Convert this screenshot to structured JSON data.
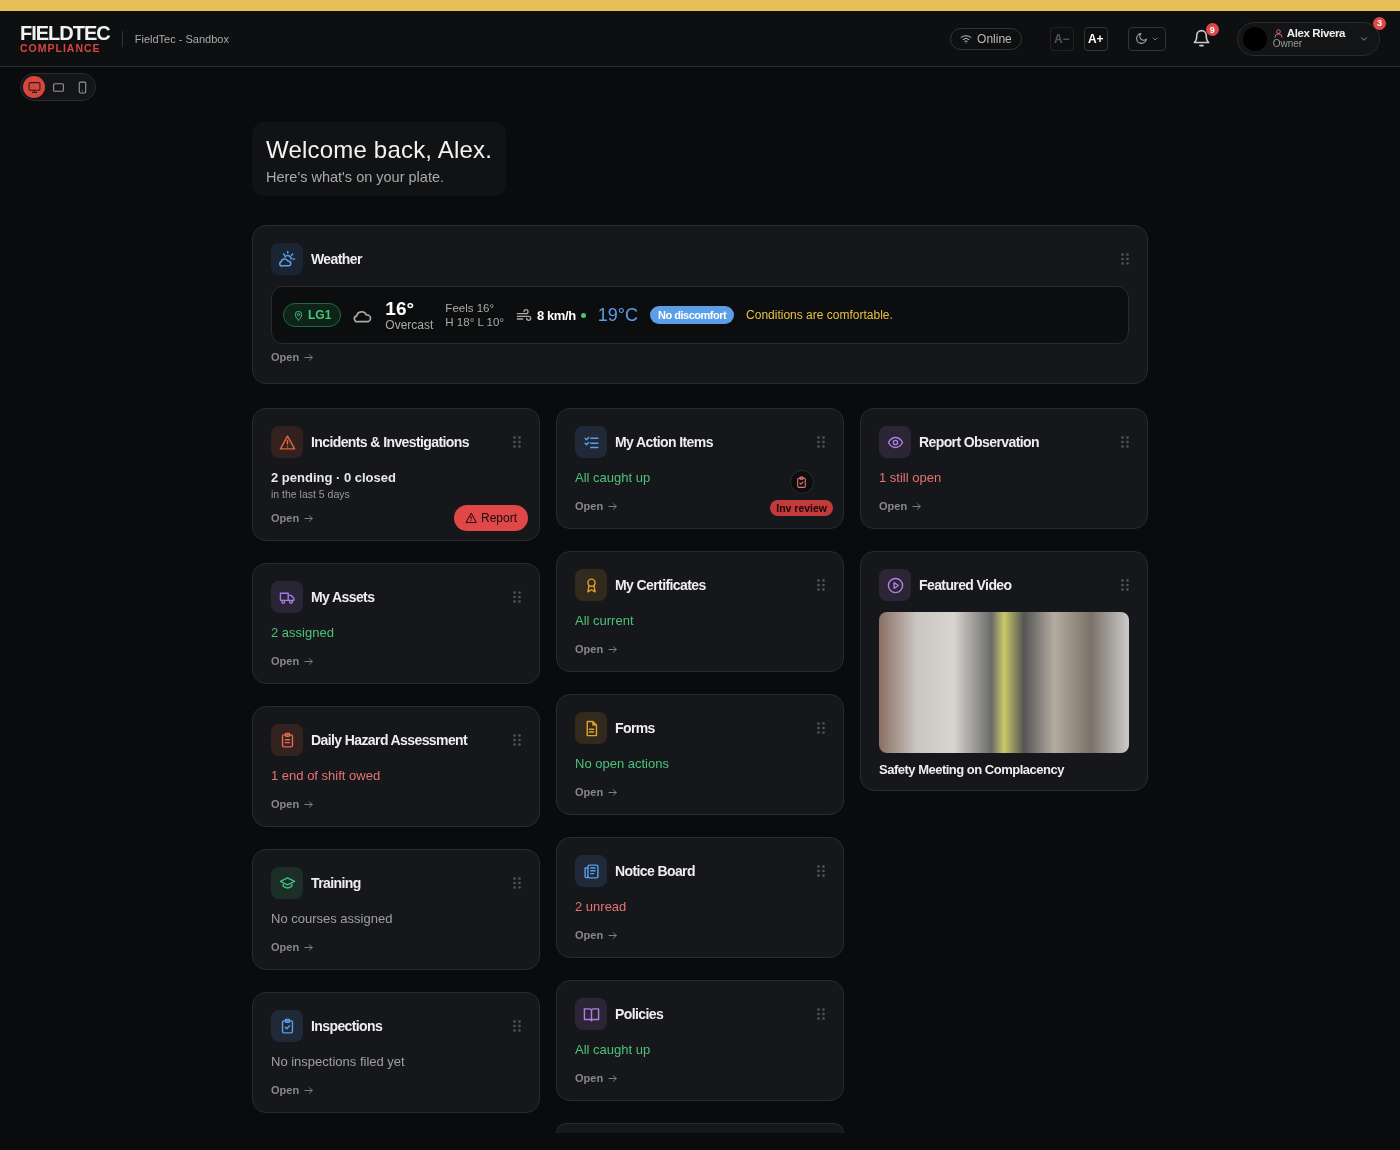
{
  "header": {
    "logo": {
      "line_1": "FIELDTEC",
      "line_2": "COMPLIANCE"
    },
    "workspace": "FieldTec - Sandbox",
    "connection": "Online",
    "font_buttons": [
      {
        "label": "A−",
        "disabled": true
      },
      {
        "label": "A+",
        "disabled": false
      }
    ],
    "theme": {
      "dark": true
    },
    "notifications": "9",
    "user": {
      "name": "Alex Rivera",
      "role": "Owner",
      "badge": "3"
    }
  },
  "devices": [
    {
      "kind": "desktop",
      "selected": true
    },
    {
      "kind": "tablet",
      "selected": false
    },
    {
      "kind": "phone",
      "selected": false
    }
  ],
  "welcome": {
    "title": "Welcome back, Alex.",
    "subtitle": "Here's what's on your plate."
  },
  "weather": {
    "title": "Weather",
    "location": "LG1",
    "temperature": "16°",
    "condition": "Overcast",
    "feels": "Feels 16°",
    "high_low": "H 18° L 10°",
    "wind": "8 km/h",
    "indoor": "19°C",
    "comfort": "No discomfort",
    "message": "Conditions are comfortable.",
    "link": "Open"
  },
  "columns": [
    [
      {
        "kind": "summary",
        "title": "Incidents & Investigations",
        "status": {
          "text": "2 pending · 0 closed",
          "color": "#e8e8e8"
        },
        "note": "in the last 5 days",
        "link": "Open",
        "action": "Report"
      },
      {
        "kind": "summary",
        "title": "My Assets",
        "status": {
          "text": "2 assigned",
          "color": "#4cc27a"
        },
        "link": "Open"
      },
      {
        "kind": "summary",
        "title": "Daily Hazard Assessment",
        "status": {
          "text": "1 end of shift owed",
          "color": "#e57373"
        },
        "link": "Open"
      },
      {
        "kind": "summary",
        "title": "Training",
        "status": {
          "text": "No courses assigned",
          "color": "#a0a0a0"
        },
        "link": "Open"
      },
      {
        "kind": "summary",
        "title": "Inspections",
        "status": {
          "text": "No inspections filed yet",
          "color": "#a0a0a0"
        },
        "link": "Open"
      }
    ],
    [
      {
        "kind": "summary",
        "title": "My Action Items",
        "status": {
          "text": "All caught up",
          "color": "#4cc27a"
        },
        "link": "Open",
        "badge": "Inv review"
      },
      {
        "kind": "summary",
        "title": "My Certificates",
        "status": {
          "text": "All current",
          "color": "#4cc27a"
        },
        "link": "Open"
      },
      {
        "kind": "summary",
        "title": "Forms",
        "status": {
          "text": "No open actions",
          "color": "#4cc27a"
        },
        "link": "Open"
      },
      {
        "kind": "summary",
        "title": "Notice Board",
        "status": {
          "text": "2 unread",
          "color": "#e57373"
        },
        "link": "Open"
      },
      {
        "kind": "summary",
        "title": "Policies",
        "status": {
          "text": "All caught up",
          "color": "#4cc27a"
        },
        "link": "Open"
      },
      {
        "kind": "partial"
      }
    ],
    [
      {
        "kind": "summary",
        "title": "Report Observation",
        "status": {
          "text": "1 still open",
          "color": "#e57373"
        },
        "link": "Open"
      },
      {
        "kind": "video",
        "title": "Featured Video",
        "caption": "Safety Meeting on Complacency"
      }
    ]
  ]
}
